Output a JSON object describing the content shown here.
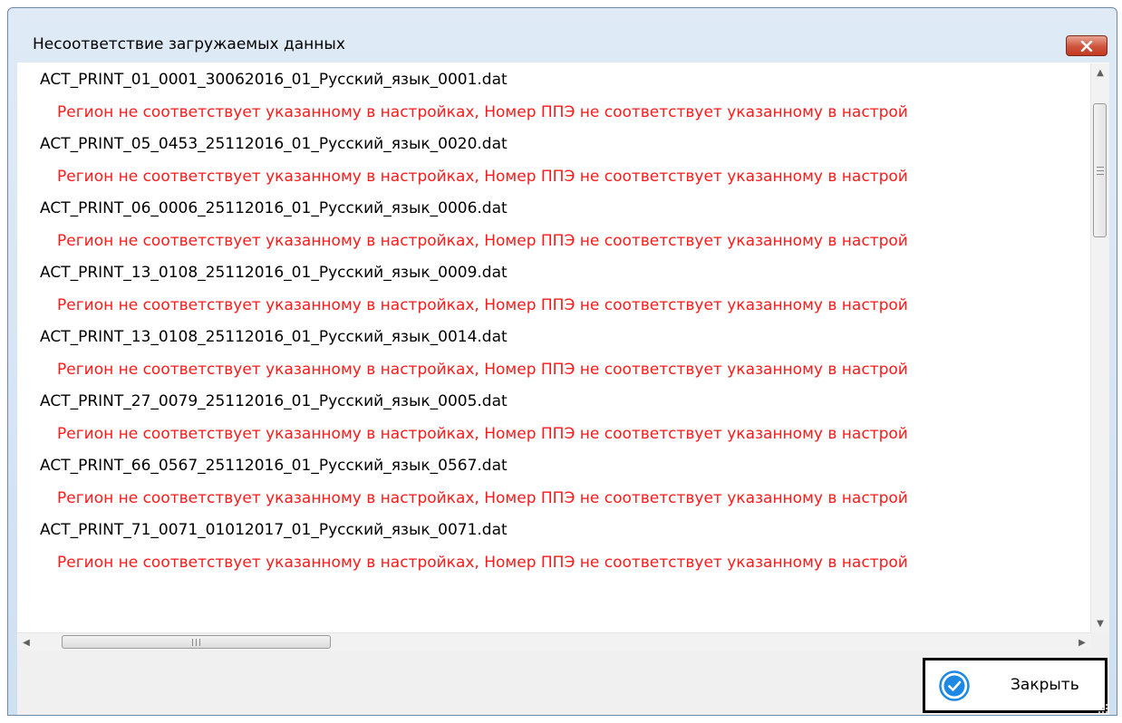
{
  "window": {
    "title": "Несоответствие загружаемых данных"
  },
  "list": {
    "entries": [
      {
        "file": "ACT_PRINT_01_0001_30062016_01_Русский_язык_0001.dat",
        "error": "Регион не соответствует указанному в настройках, Номер ППЭ не соответствует указанному в настрой"
      },
      {
        "file": "ACT_PRINT_05_0453_25112016_01_Русский_язык_0020.dat",
        "error": "Регион не соответствует указанному в настройках, Номер ППЭ не соответствует указанному в настрой"
      },
      {
        "file": "ACT_PRINT_06_0006_25112016_01_Русский_язык_0006.dat",
        "error": "Регион не соответствует указанному в настройках, Номер ППЭ не соответствует указанному в настрой"
      },
      {
        "file": "ACT_PRINT_13_0108_25112016_01_Русский_язык_0009.dat",
        "error": "Регион не соответствует указанному в настройках, Номер ППЭ не соответствует указанному в настрой"
      },
      {
        "file": "ACT_PRINT_13_0108_25112016_01_Русский_язык_0014.dat",
        "error": "Регион не соответствует указанному в настройках, Номер ППЭ не соответствует указанному в настрой"
      },
      {
        "file": "ACT_PRINT_27_0079_25112016_01_Русский_язык_0005.dat",
        "error": "Регион не соответствует указанному в настройках, Номер ППЭ не соответствует указанному в настрой"
      },
      {
        "file": "ACT_PRINT_66_0567_25112016_01_Русский_язык_0567.dat",
        "error": "Регион не соответствует указанному в настройках, Номер ППЭ не соответствует указанному в настрой"
      },
      {
        "file": "ACT_PRINT_71_0071_01012017_01_Русский_язык_0071.dat",
        "error": "Регион не соответствует указанному в настройках, Номер ППЭ не соответствует указанному в настрой"
      }
    ]
  },
  "buttons": {
    "close_label": "Закрыть",
    "close_icon": "check-circle-icon"
  },
  "colors": {
    "error_text": "#ff1a1a",
    "accent": "#1e88e5"
  }
}
